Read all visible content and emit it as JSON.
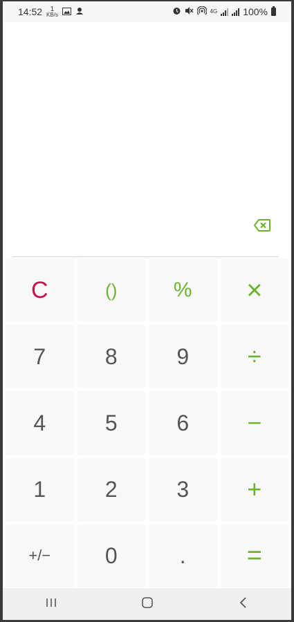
{
  "status_bar": {
    "time": "14:52",
    "net_speed_value": "1",
    "net_speed_unit": "KB/s",
    "network_type": "4G",
    "battery": "100%",
    "left_icons": [
      "image-icon",
      "notification-icon"
    ],
    "right_icons": [
      "alarm-icon",
      "mute-icon",
      "hotspot-icon",
      "signal-icon",
      "signal-icon",
      "battery-icon"
    ]
  },
  "display": {
    "expression": "",
    "backspace_icon": "backspace-icon"
  },
  "keypad": {
    "rows": [
      [
        {
          "label": "C",
          "name": "clear-button",
          "color": "#c0134f"
        },
        {
          "label": "()",
          "name": "parentheses-button",
          "color": "#6ab42f"
        },
        {
          "label": "%",
          "name": "percent-button",
          "color": "#6ab42f"
        },
        {
          "label": "×",
          "name": "multiply-button",
          "color": "#6ab42f"
        }
      ],
      [
        {
          "label": "7",
          "name": "digit-7-button"
        },
        {
          "label": "8",
          "name": "digit-8-button"
        },
        {
          "label": "9",
          "name": "digit-9-button"
        },
        {
          "label": "÷",
          "name": "divide-button",
          "color": "#6ab42f"
        }
      ],
      [
        {
          "label": "4",
          "name": "digit-4-button"
        },
        {
          "label": "5",
          "name": "digit-5-button"
        },
        {
          "label": "6",
          "name": "digit-6-button"
        },
        {
          "label": "−",
          "name": "subtract-button",
          "color": "#6ab42f"
        }
      ],
      [
        {
          "label": "1",
          "name": "digit-1-button"
        },
        {
          "label": "2",
          "name": "digit-2-button"
        },
        {
          "label": "3",
          "name": "digit-3-button"
        },
        {
          "label": "+",
          "name": "add-button",
          "color": "#6ab42f"
        }
      ],
      [
        {
          "label": "+/−",
          "name": "plus-minus-button"
        },
        {
          "label": "0",
          "name": "digit-0-button"
        },
        {
          "label": ".",
          "name": "decimal-button"
        },
        {
          "label": "=",
          "name": "equals-button",
          "color": "#6ab42f"
        }
      ]
    ]
  },
  "nav_bar": {
    "icons": [
      "recent-apps-icon",
      "home-icon",
      "back-icon"
    ]
  },
  "colors": {
    "accent": "#6ab42f",
    "clear": "#c0134f",
    "digit": "#555555",
    "key_bg": "#f8f8f8"
  }
}
